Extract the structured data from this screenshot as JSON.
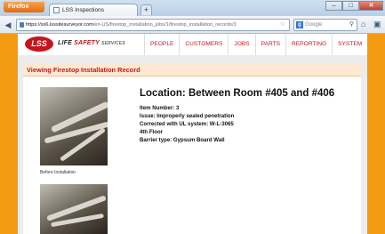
{
  "browser": {
    "app_button": "Firefox",
    "tab_title": "LSS Inspections",
    "url_host": "https://ss6.lsssitesurveyor.com",
    "url_path": "/en-US/firestop_installation_jobs/1/firestop_installation_records/3",
    "search_placeholder": "Google",
    "newtab_glyph": "+",
    "win_min": "–",
    "win_max": "□",
    "win_close": "✕"
  },
  "site": {
    "logo": "LSS",
    "logo_line1": "LIFE",
    "logo_line2": "SAFETY",
    "logo_line3": "SERVICES",
    "menu": [
      "PEOPLE",
      "CUSTOMERS",
      "JOBS",
      "PARTS",
      "REPORTING",
      "SYSTEM"
    ]
  },
  "record": {
    "panel_title": "Viewing Firestop Installation Record",
    "location": "Location: Between Room #405 and #406",
    "details": [
      "Item Number: 3",
      "Issue: Improperly sealed penetration",
      "Corrected with UL system: W-L-3065",
      "4th Floor",
      "Barrier type: Gypsum Board Wall"
    ],
    "before_caption": "Before Installation"
  },
  "colors": {
    "brand_red": "#c4161c",
    "background_orange": "#f39a12"
  }
}
